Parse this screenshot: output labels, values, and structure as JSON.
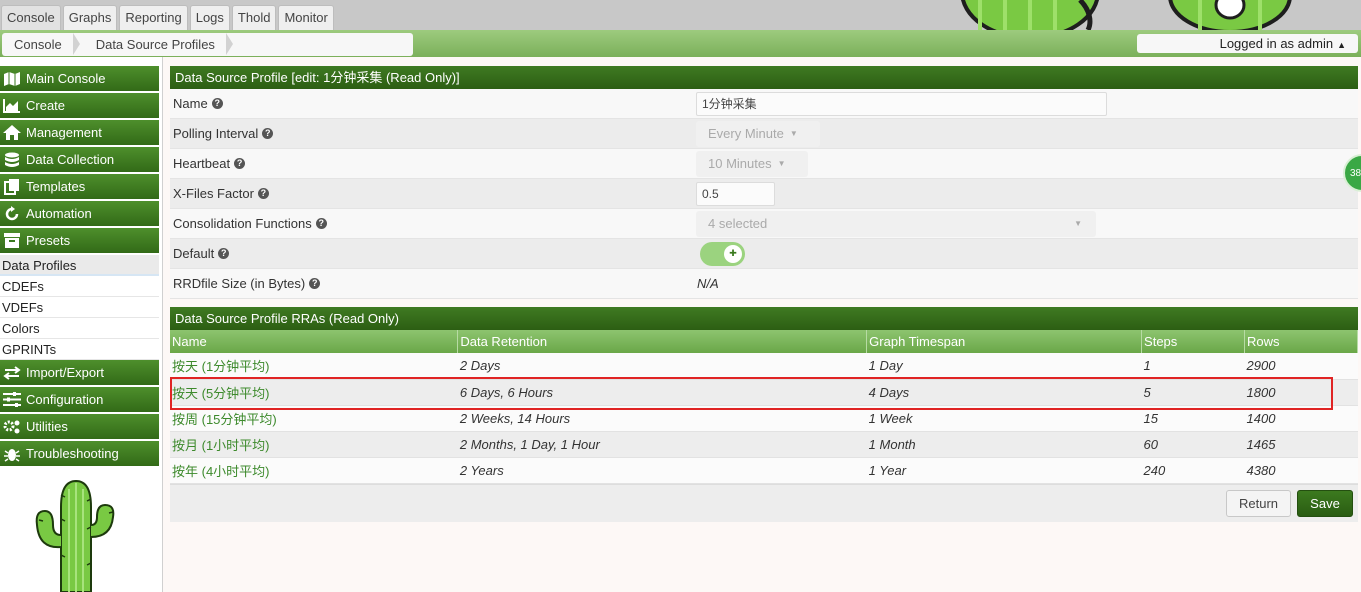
{
  "top_tabs": [
    "Console",
    "Graphs",
    "Reporting",
    "Logs",
    "Thold",
    "Monitor"
  ],
  "breadcrumb": [
    "Console",
    "Data Source Profiles"
  ],
  "user": {
    "login_text": "Logged in as admin"
  },
  "sidebar": {
    "main_console": "Main Console",
    "create": "Create",
    "management": "Management",
    "data_collection": "Data Collection",
    "templates": "Templates",
    "automation": "Automation",
    "presets": "Presets",
    "preset_items": [
      "Data Profiles",
      "CDEFs",
      "VDEFs",
      "Colors",
      "GPRINTs"
    ],
    "import_export": "Import/Export",
    "configuration": "Configuration",
    "utilities": "Utilities",
    "troubleshooting": "Troubleshooting"
  },
  "form": {
    "title": "Data Source Profile [edit: 1分钟采集 (Read Only)]",
    "name": {
      "label": "Name",
      "value": "1分钟采集"
    },
    "polling_interval": {
      "label": "Polling Interval",
      "value": "Every Minute"
    },
    "heartbeat": {
      "label": "Heartbeat",
      "value": "10 Minutes"
    },
    "xff": {
      "label": "X-Files Factor",
      "value": "0.5"
    },
    "cf": {
      "label": "Consolidation Functions",
      "value": "4 selected"
    },
    "default": {
      "label": "Default"
    },
    "rrd_size": {
      "label": "RRDfile Size (in Bytes)",
      "value": "N/A"
    }
  },
  "rra": {
    "title": "Data Source Profile RRAs (Read Only)",
    "columns": [
      "Name",
      "Data Retention",
      "Graph Timespan",
      "Steps",
      "Rows"
    ],
    "rows": [
      [
        "按天 (1分钟平均)",
        "2 Days",
        "1 Day",
        "1",
        "2900"
      ],
      [
        "按天 (5分钟平均)",
        "6 Days, 6 Hours",
        "4 Days",
        "5",
        "1800"
      ],
      [
        "按周 (15分钟平均)",
        "2 Weeks, 14 Hours",
        "1 Week",
        "15",
        "1400"
      ],
      [
        "按月 (1小时平均)",
        "2 Months, 1 Day, 1 Hour",
        "1 Month",
        "60",
        "1465"
      ],
      [
        "按年 (4小时平均)",
        "2 Years",
        "1 Year",
        "240",
        "4380"
      ]
    ]
  },
  "buttons": {
    "return": "Return",
    "save": "Save"
  },
  "badge": "38",
  "colors": {
    "header_green": "#326a17",
    "table_header_green": "#7bb05a",
    "highlight_red": "#e02424"
  }
}
